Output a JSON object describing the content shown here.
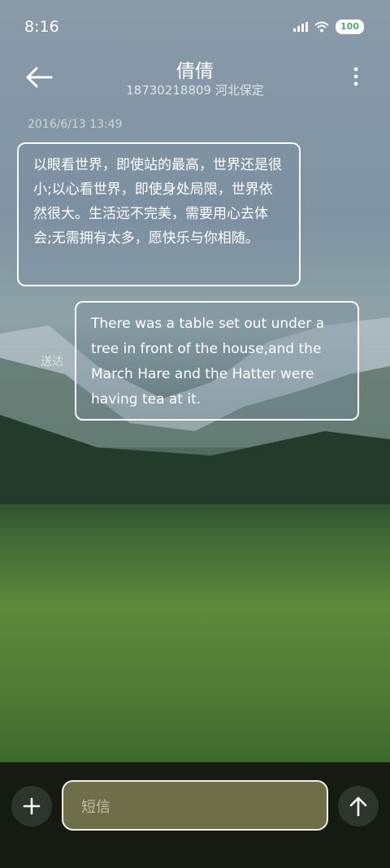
{
  "status": {
    "time": "8:16",
    "battery": "100"
  },
  "header": {
    "contact_name": "倩倩",
    "contact_info": "18730218809 河北保定"
  },
  "conversation": {
    "timestamp": "2016/6/13 13:49",
    "messages": [
      {
        "direction": "incoming",
        "text": "以眼看世界，即使站的最高，世界还是很小;以心看世界，即使身处局限，世界依然很大。生活远不完美，需要用心去体会;无需拥有太多，愿快乐与你相随。"
      },
      {
        "direction": "outgoing",
        "text": "There was a table set out under a tree in front of the house,and the March Hare and the Hatter were having tea at it.",
        "status": "送达"
      }
    ]
  },
  "composer": {
    "placeholder": "短信"
  },
  "icons": [
    "back-arrow-icon",
    "more-vert-icon",
    "plus-icon",
    "send-arrow-icon",
    "signal-icon",
    "wifi-icon",
    "battery-icon"
  ]
}
